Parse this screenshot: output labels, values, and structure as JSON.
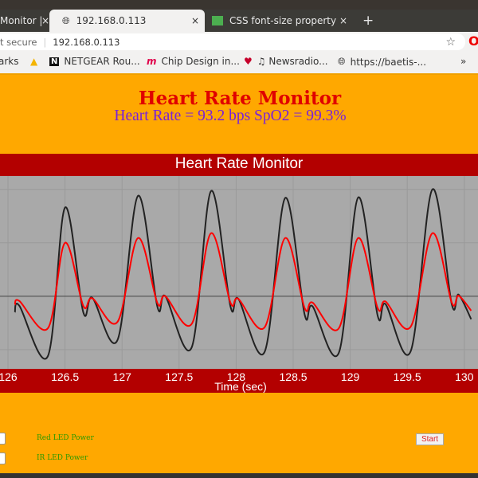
{
  "browser": {
    "tabs": [
      {
        "label": "Monitor |"
      },
      {
        "label": "192.168.0.113",
        "active": true
      },
      {
        "label": "CSS font-size property"
      }
    ],
    "new_tab": "+",
    "close": "×",
    "security": "t secure",
    "url": "192.168.0.113",
    "bookmarks": [
      {
        "label": "arks"
      },
      {
        "label": "NETGEAR Rou..."
      },
      {
        "label": "Chip Design in..."
      },
      {
        "label": "♫ Newsradio..."
      },
      {
        "label": "https://baetis-..."
      }
    ],
    "overflow": "»"
  },
  "page": {
    "title": "Heart Rate Monitor",
    "subtitle": "Heart Rate = 93.2 bps SpO2 = 99.3%",
    "controls": {
      "red_led": "Red LED Power",
      "ir_led": "IR LED Power",
      "start": "Start"
    }
  },
  "colors": {
    "page_bg": "#ffa800",
    "chart_band": "#b30000",
    "plot_bg": "#a9a9a9",
    "red_series": "#ff0000",
    "black_series": "#222222"
  },
  "chart_data": {
    "type": "line",
    "title": "Heart Rate Monitor",
    "xlabel": "Time (sec)",
    "ylabel": "",
    "xlim": [
      125.93,
      130.12
    ],
    "ylim": [
      -1.36,
      2.25
    ],
    "grid": true,
    "x_ticks": [
      "126",
      "126.5",
      "127",
      "127.5",
      "128",
      "128.5",
      "129",
      "129.5",
      "130"
    ],
    "y_grid": [
      -1,
      0,
      1,
      2
    ],
    "series": [
      {
        "color": "#222222",
        "points": [
          [
            126.06,
            -0.3
          ],
          [
            126.1,
            -0.18
          ],
          [
            126.35,
            -1.12
          ],
          [
            126.5,
            1.66
          ],
          [
            126.66,
            -0.3
          ],
          [
            126.74,
            -0.03
          ],
          [
            126.96,
            -0.82
          ],
          [
            127.14,
            1.88
          ],
          [
            127.31,
            -0.2
          ],
          [
            127.38,
            0
          ],
          [
            127.61,
            -0.96
          ],
          [
            127.78,
            1.97
          ],
          [
            127.95,
            -0.19
          ],
          [
            128.02,
            -0.05
          ],
          [
            128.25,
            -1.04
          ],
          [
            128.43,
            1.84
          ],
          [
            128.6,
            -0.34
          ],
          [
            128.67,
            -0.19
          ],
          [
            128.9,
            -1.06
          ],
          [
            129.07,
            1.85
          ],
          [
            129.24,
            -0.36
          ],
          [
            129.31,
            -0.15
          ],
          [
            129.53,
            -1.03
          ],
          [
            129.72,
            2.0
          ],
          [
            129.89,
            -0.15
          ],
          [
            129.95,
            0.03
          ],
          [
            130.06,
            -0.43
          ]
        ]
      },
      {
        "color": "#ff0000",
        "points": [
          [
            126.06,
            -0.16
          ],
          [
            126.1,
            -0.09
          ],
          [
            126.35,
            -0.6
          ],
          [
            126.5,
            1.0
          ],
          [
            126.66,
            -0.18
          ],
          [
            126.74,
            -0.04
          ],
          [
            126.96,
            -0.48
          ],
          [
            127.14,
            1.09
          ],
          [
            127.31,
            -0.13
          ],
          [
            127.38,
            0
          ],
          [
            127.61,
            -0.52
          ],
          [
            127.78,
            1.18
          ],
          [
            127.95,
            -0.12
          ],
          [
            128.02,
            -0.05
          ],
          [
            128.25,
            -0.58
          ],
          [
            128.43,
            1.09
          ],
          [
            128.6,
            -0.22
          ],
          [
            128.67,
            -0.12
          ],
          [
            128.9,
            -0.6
          ],
          [
            129.07,
            1.09
          ],
          [
            129.24,
            -0.22
          ],
          [
            129.31,
            -0.1
          ],
          [
            129.53,
            -0.57
          ],
          [
            129.72,
            1.18
          ],
          [
            129.89,
            -0.12
          ],
          [
            129.95,
            0.01
          ],
          [
            130.06,
            -0.27
          ]
        ]
      }
    ]
  }
}
